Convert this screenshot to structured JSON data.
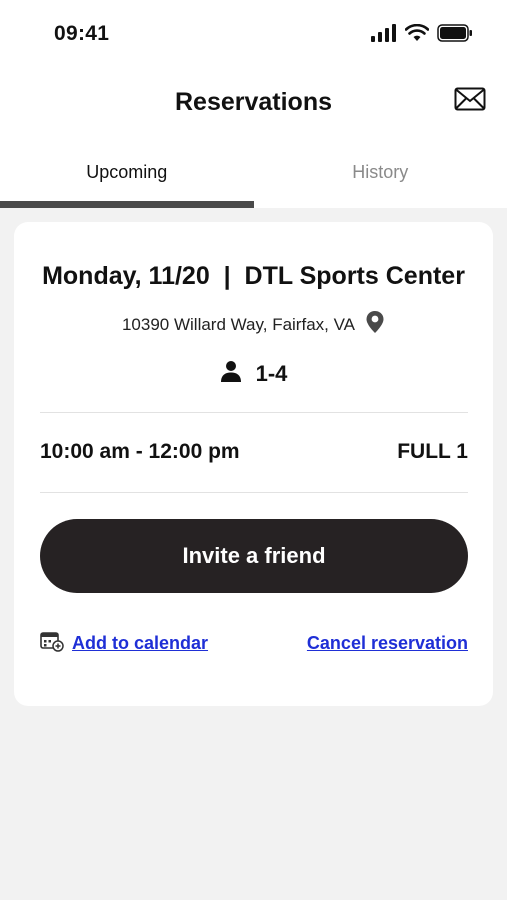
{
  "status_bar": {
    "time": "09:41"
  },
  "header": {
    "title": "Reservations",
    "mail_icon": "envelope-icon"
  },
  "tabs": [
    {
      "label": "Upcoming",
      "active": true
    },
    {
      "label": "History",
      "active": false
    }
  ],
  "reservation": {
    "title": "Monday, 11/20  |  DTL Sports Center",
    "address": "10390 Willard Way, Fairfax, VA",
    "capacity": "1-4",
    "time_range": "10:00 am - 12:00 pm",
    "status": "FULL 1",
    "invite_label": "Invite a friend",
    "add_calendar_label": "Add to calendar",
    "cancel_label": "Cancel reservation"
  },
  "colors": {
    "tab_indicator": "#4a4a4a",
    "button_bg": "#262223",
    "link": "#1f2fd6",
    "background": "#f2f2f2"
  }
}
